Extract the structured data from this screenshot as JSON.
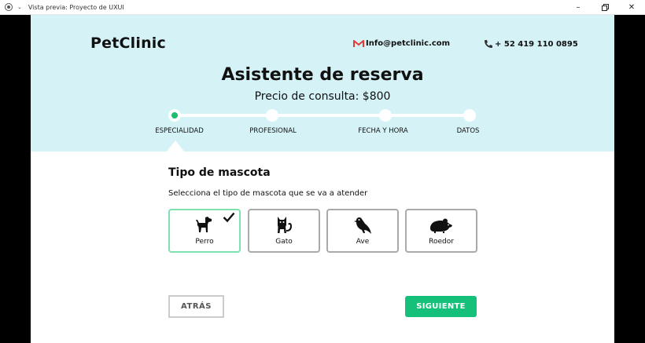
{
  "window": {
    "title": "Vista previa: Proyecto de UXUI",
    "controls": [
      "minimize",
      "restore",
      "close"
    ]
  },
  "header": {
    "brand": "PetClinic",
    "email": "Info@petclinic.com",
    "phone": "+ 52 419 110 0895",
    "email_icon_color": "#e53935"
  },
  "hero": {
    "title": "Asistente de reserva",
    "subtitle": "Precio de consulta: $800"
  },
  "steps": [
    {
      "label": "ESPECIALIDAD",
      "active": true
    },
    {
      "label": "PROFESIONAL",
      "active": false
    },
    {
      "label": "FECHA Y HORA",
      "active": false
    },
    {
      "label": "DATOS",
      "active": false
    }
  ],
  "pet_section": {
    "title": "Tipo de mascota",
    "description": "Selecciona el tipo de mascota que se va a atender",
    "options": [
      {
        "label": "Perro",
        "icon": "dog-icon",
        "selected": true
      },
      {
        "label": "Gato",
        "icon": "cat-icon",
        "selected": false
      },
      {
        "label": "Ave",
        "icon": "bird-icon",
        "selected": false
      },
      {
        "label": "Roedor",
        "icon": "rodent-icon",
        "selected": false
      }
    ]
  },
  "actions": {
    "back": "ATRÁS",
    "next": "SIGUIENTE"
  },
  "colors": {
    "hero_bg": "#d5f3f7",
    "accent": "#14c07a",
    "selected_border": "#7fe0b0"
  }
}
